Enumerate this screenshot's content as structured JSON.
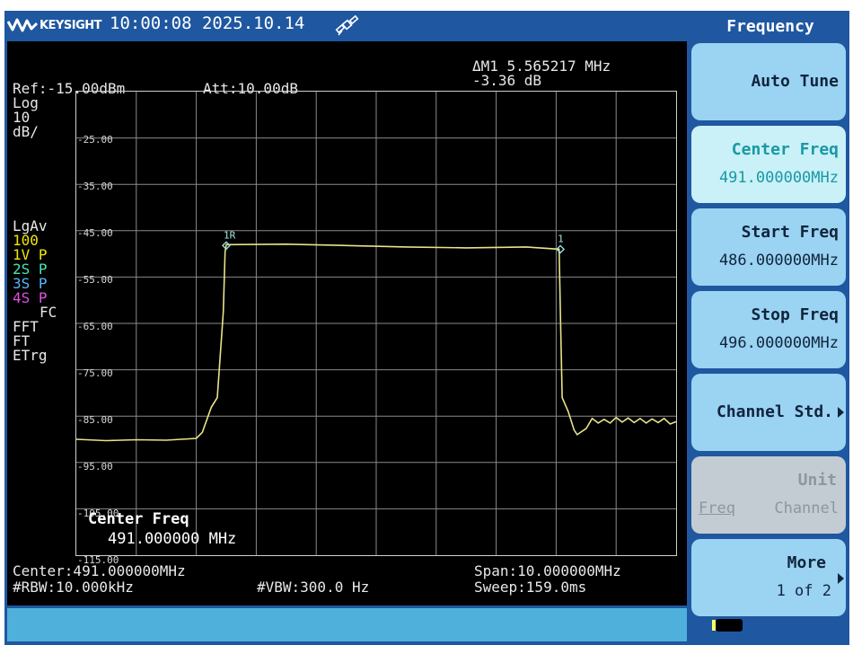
{
  "topbar": {
    "brand": "KEYSIGHT",
    "datetime": "10:00:08 2025.10.14",
    "icons": [
      "keysight-logo-icon",
      "satellite-icon",
      "battery-icon"
    ]
  },
  "menu": {
    "title": "Frequency",
    "softkeys": {
      "auto_tune": "Auto Tune",
      "center_freq_label": "Center Freq",
      "center_freq_value": "491.000000MHz",
      "start_freq_label": "Start Freq",
      "start_freq_value": "486.000000MHz",
      "stop_freq_label": "Stop Freq",
      "stop_freq_value": "496.000000MHz",
      "channel_std": "Channel Std.",
      "unit_label": "Unit",
      "unit_freq": "Freq",
      "unit_channel": "Channel",
      "more_label": "More",
      "more_page": "1 of 2"
    }
  },
  "display": {
    "ref": "Ref:-15.00dBm",
    "att": "Att:10.00dB",
    "delta_marker": "ΔM1 5.565217 MHz",
    "delta_value": "-3.36 dB",
    "scale": [
      "Log",
      "10",
      "dB/"
    ],
    "trace_info": {
      "lgav": "LgAv",
      "avg_count": "100",
      "t1": "1V P",
      "t2": "2S P",
      "t3": "3S P",
      "t4": "4S P",
      "fc": "FC",
      "fft": "FFT",
      "ft": "FT",
      "etrg": "ETrg"
    },
    "y_ticks": [
      "-25.00",
      "-35.00",
      "-45.00",
      "-55.00",
      "-65.00",
      "-75.00",
      "-85.00",
      "-95.00",
      "-105.00",
      "-115.00"
    ],
    "markers": {
      "ref_marker": "1R",
      "marker1": "1"
    },
    "overlay_label": "Center Freq",
    "overlay_value": "491.000000 MHz",
    "center": "Center:491.000000MHz",
    "span": "Span:10.000000MHz",
    "rbw": "#RBW:10.000kHz",
    "vbw": "#VBW:300.0 Hz",
    "sweep": "Sweep:159.0ms"
  },
  "colors": {
    "frame": "#1f57a0",
    "trace": "#e8e38a",
    "marker": "#9fe6e0",
    "trace1": "#f2e600",
    "trace2": "#48e6b0",
    "trace3": "#55b8ff",
    "trace4": "#e050e0",
    "softkey": "#9bd3f2",
    "softkey_active": "#c9f1f7",
    "softkey_disabled": "#c3ccd3",
    "status_bar": "#4fb0db"
  },
  "chart_data": {
    "type": "line",
    "x_unit": "MHz",
    "y_unit": "dBm",
    "xlim": [
      486.0,
      496.0
    ],
    "ylim": [
      -117.5,
      -17.5
    ],
    "grid": true,
    "series": [
      {
        "x": [
          486.0,
          486.5,
          487.0,
          487.5,
          488.0,
          488.1,
          488.25,
          488.35,
          488.45,
          488.48,
          488.5,
          489.5,
          490.5,
          491.5,
          492.5,
          493.5,
          494.05,
          494.07,
          494.1,
          494.2,
          494.3,
          494.35,
          494.5,
          494.6,
          494.7,
          494.8,
          494.9,
          495.0,
          495.1,
          495.2,
          495.3,
          495.4,
          495.5,
          495.6,
          495.7,
          495.8,
          495.9,
          496.0
        ],
        "y": [
          -92.5,
          -92.8,
          -92.6,
          -92.7,
          -92.3,
          -91.0,
          -85.6,
          -83.5,
          -65.0,
          -52.0,
          -50.5,
          -50.4,
          -50.7,
          -51.0,
          -51.2,
          -51.0,
          -51.5,
          -65.0,
          -83.5,
          -86.5,
          -90.5,
          -91.5,
          -90.2,
          -88.0,
          -89.0,
          -88.2,
          -89.0,
          -87.8,
          -88.8,
          -87.9,
          -88.9,
          -88.0,
          -89.0,
          -88.1,
          -88.9,
          -88.0,
          -89.2,
          -88.7
        ]
      }
    ],
    "markers": [
      {
        "name": "1R",
        "x": 488.5,
        "y": -50.7
      },
      {
        "name": "1",
        "x": 494.07,
        "y": -51.5
      }
    ]
  }
}
